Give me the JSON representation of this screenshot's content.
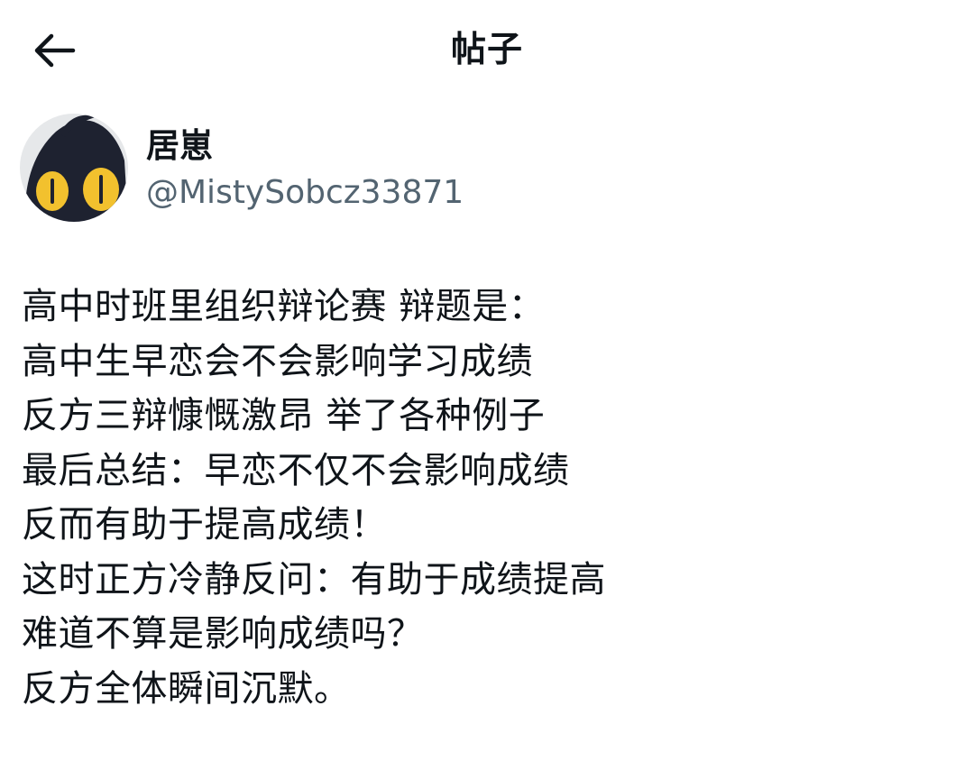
{
  "header": {
    "title": "帖子",
    "back_icon": "arrow-left-icon"
  },
  "author": {
    "display_name": "居崽",
    "handle": "@MistySobcz33871",
    "avatar_icon": "cartoon-cat-avatar-icon"
  },
  "post": {
    "lines": [
      "高中时班里组织辩论赛 辩题是：",
      "高中生早恋会不会影响学习成绩",
      "反方三辩慷慨激昂 举了各种例子",
      "最后总结：早恋不仅不会影响成绩",
      "反而有助于提高成绩！",
      "这时正方冷静反问：有助于成绩提高",
      "难道不算是影响成绩吗？",
      "反方全体瞬间沉默。"
    ]
  },
  "colors": {
    "text_primary": "#0f1419",
    "text_secondary": "#536471",
    "background": "#ffffff",
    "avatar_bg": "#e6e8ea",
    "avatar_figure": "#1e2230",
    "avatar_eyes": "#f2c12e"
  }
}
